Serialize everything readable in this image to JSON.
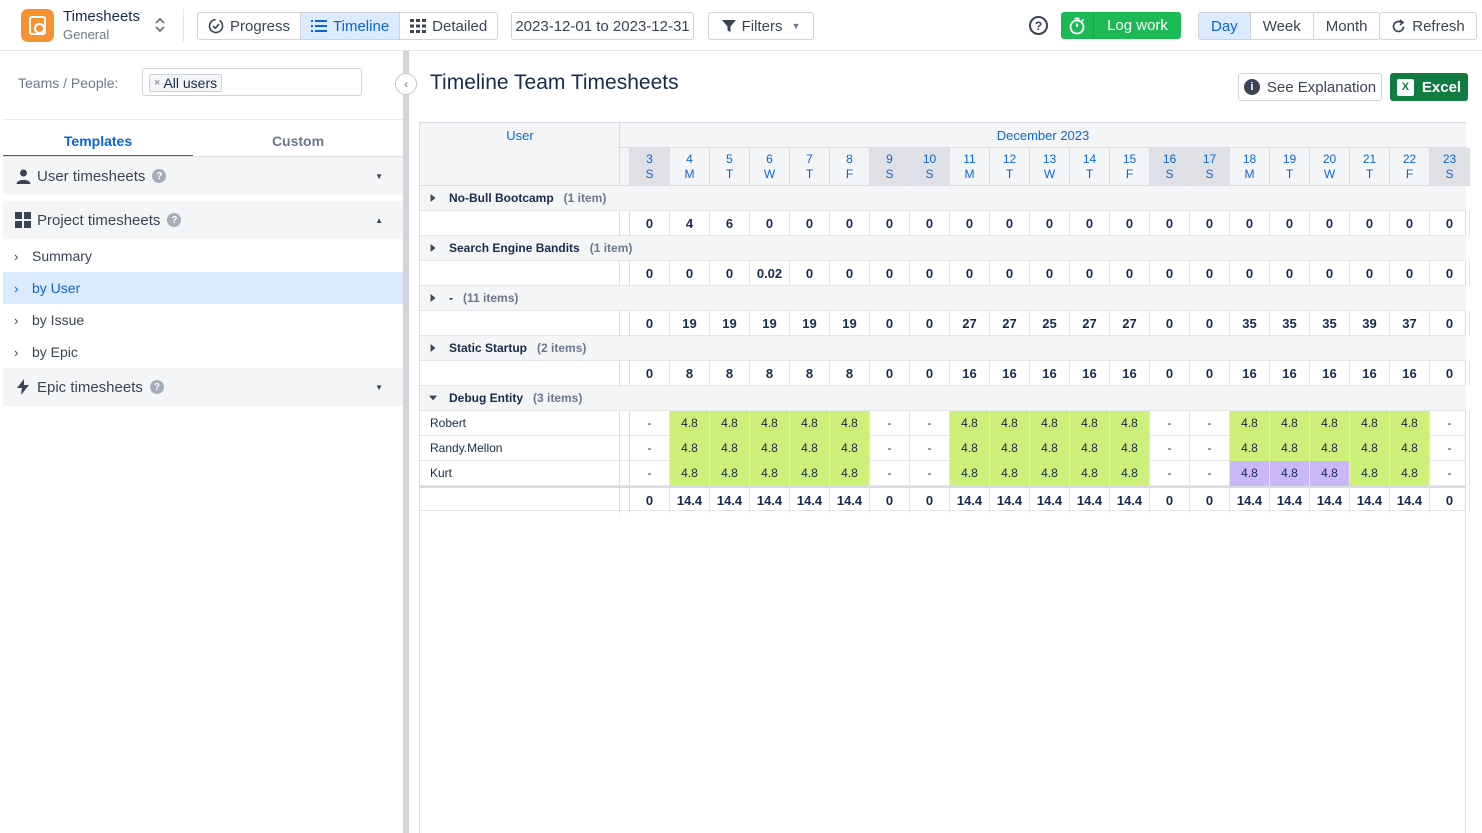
{
  "app": {
    "name": "Timesheets",
    "subtitle": "General"
  },
  "views": [
    {
      "label": "Progress",
      "icon": "progress-icon",
      "active": false
    },
    {
      "label": "Timeline",
      "icon": "list-icon",
      "active": true
    },
    {
      "label": "Detailed",
      "icon": "grid-icon",
      "active": false
    }
  ],
  "date_range": "2023-12-01 to 2023-12-31",
  "filters_label": "Filters",
  "log_work_label": "Log work",
  "periods": [
    {
      "label": "Day",
      "active": true
    },
    {
      "label": "Week",
      "active": false
    },
    {
      "label": "Month",
      "active": false
    }
  ],
  "refresh_label": "Refresh",
  "sidebar": {
    "teams_label": "Teams / People:",
    "selected_user_chip": "All users",
    "tabs": [
      "Templates",
      "Custom"
    ],
    "sections": {
      "user": "User timesheets",
      "project": "Project timesheets",
      "epic": "Epic timesheets"
    },
    "project_items": [
      "Summary",
      "by User",
      "by Issue",
      "by Epic"
    ],
    "active_item": "by User"
  },
  "main": {
    "title": "Timeline Team Timesheets",
    "explain_label": "See Explanation",
    "excel_label": "Excel"
  },
  "grid": {
    "user_header": "User",
    "month": "December 2023",
    "days": [
      {
        "d": "3",
        "w": "S",
        "we": true
      },
      {
        "d": "4",
        "w": "M",
        "we": false
      },
      {
        "d": "5",
        "w": "T",
        "we": false
      },
      {
        "d": "6",
        "w": "W",
        "we": false
      },
      {
        "d": "7",
        "w": "T",
        "we": false
      },
      {
        "d": "8",
        "w": "F",
        "we": false
      },
      {
        "d": "9",
        "w": "S",
        "we": true
      },
      {
        "d": "10",
        "w": "S",
        "we": true
      },
      {
        "d": "11",
        "w": "M",
        "we": false
      },
      {
        "d": "12",
        "w": "T",
        "we": false
      },
      {
        "d": "13",
        "w": "W",
        "we": false
      },
      {
        "d": "14",
        "w": "T",
        "we": false
      },
      {
        "d": "15",
        "w": "F",
        "we": false
      },
      {
        "d": "16",
        "w": "S",
        "we": true
      },
      {
        "d": "17",
        "w": "S",
        "we": true
      },
      {
        "d": "18",
        "w": "M",
        "we": false
      },
      {
        "d": "19",
        "w": "T",
        "we": false
      },
      {
        "d": "20",
        "w": "W",
        "we": false
      },
      {
        "d": "21",
        "w": "T",
        "we": false
      },
      {
        "d": "22",
        "w": "F",
        "we": false
      },
      {
        "d": "23",
        "w": "S",
        "we": true
      }
    ],
    "groups": [
      {
        "name": "No-Bull Bootcamp",
        "count": "(1 item)",
        "expanded": false,
        "totals": [
          "0",
          "4",
          "6",
          "0",
          "0",
          "0",
          "0",
          "0",
          "0",
          "0",
          "0",
          "0",
          "0",
          "0",
          "0",
          "0",
          "0",
          "0",
          "0",
          "0",
          "0"
        ]
      },
      {
        "name": "Search Engine Bandits",
        "count": "(1 item)",
        "expanded": false,
        "totals": [
          "0",
          "0",
          "0",
          "0.02",
          "0",
          "0",
          "0",
          "0",
          "0",
          "0",
          "0",
          "0",
          "0",
          "0",
          "0",
          "0",
          "0",
          "0",
          "0",
          "0",
          "0"
        ]
      },
      {
        "name": "-",
        "count": "(11 items)",
        "expanded": false,
        "totals": [
          "0",
          "19",
          "19",
          "19",
          "19",
          "19",
          "0",
          "0",
          "27",
          "27",
          "25",
          "27",
          "27",
          "0",
          "0",
          "35",
          "35",
          "35",
          "39",
          "37",
          "0"
        ]
      },
      {
        "name": "Static Startup",
        "count": "(2 items)",
        "expanded": false,
        "totals": [
          "0",
          "8",
          "8",
          "8",
          "8",
          "8",
          "0",
          "0",
          "16",
          "16",
          "16",
          "16",
          "16",
          "0",
          "0",
          "16",
          "16",
          "16",
          "16",
          "16",
          "0"
        ]
      },
      {
        "name": "Debug Entity",
        "count": "(3 items)",
        "expanded": true,
        "rows": [
          {
            "user": "Robert",
            "values": [
              "-",
              "4.8",
              "4.8",
              "4.8",
              "4.8",
              "4.8",
              "-",
              "-",
              "4.8",
              "4.8",
              "4.8",
              "4.8",
              "4.8",
              "-",
              "-",
              "4.8",
              "4.8",
              "4.8",
              "4.8",
              "4.8",
              "-"
            ],
            "colors": [
              "",
              "g",
              "g",
              "g",
              "g",
              "g",
              "",
              "",
              "g",
              "g",
              "g",
              "g",
              "g",
              "",
              "",
              "g",
              "g",
              "g",
              "g",
              "g",
              ""
            ]
          },
          {
            "user": "Randy.Mellon",
            "values": [
              "-",
              "4.8",
              "4.8",
              "4.8",
              "4.8",
              "4.8",
              "-",
              "-",
              "4.8",
              "4.8",
              "4.8",
              "4.8",
              "4.8",
              "-",
              "-",
              "4.8",
              "4.8",
              "4.8",
              "4.8",
              "4.8",
              "-"
            ],
            "colors": [
              "",
              "g",
              "g",
              "g",
              "g",
              "g",
              "",
              "",
              "g",
              "g",
              "g",
              "g",
              "g",
              "",
              "",
              "g",
              "g",
              "g",
              "g",
              "g",
              ""
            ]
          },
          {
            "user": "Kurt",
            "values": [
              "-",
              "4.8",
              "4.8",
              "4.8",
              "4.8",
              "4.8",
              "-",
              "-",
              "4.8",
              "4.8",
              "4.8",
              "4.8",
              "4.8",
              "-",
              "-",
              "4.8",
              "4.8",
              "4.8",
              "4.8",
              "4.8",
              "-"
            ],
            "colors": [
              "",
              "g",
              "g",
              "g",
              "g",
              "g",
              "",
              "",
              "g",
              "g",
              "g",
              "g",
              "g",
              "",
              "",
              "p",
              "p",
              "p",
              "g",
              "g",
              ""
            ]
          }
        ],
        "totals": [
          "0",
          "14.4",
          "14.4",
          "14.4",
          "14.4",
          "14.4",
          "0",
          "0",
          "14.4",
          "14.4",
          "14.4",
          "14.4",
          "14.4",
          "0",
          "0",
          "14.4",
          "14.4",
          "14.4",
          "14.4",
          "14.4",
          "0"
        ]
      }
    ]
  },
  "colors": {
    "accent": "#0b66d0",
    "logwork": "#1db954",
    "excel": "#107c41",
    "cell_green": "#cdf07a",
    "cell_purple": "#c9b8f5"
  }
}
